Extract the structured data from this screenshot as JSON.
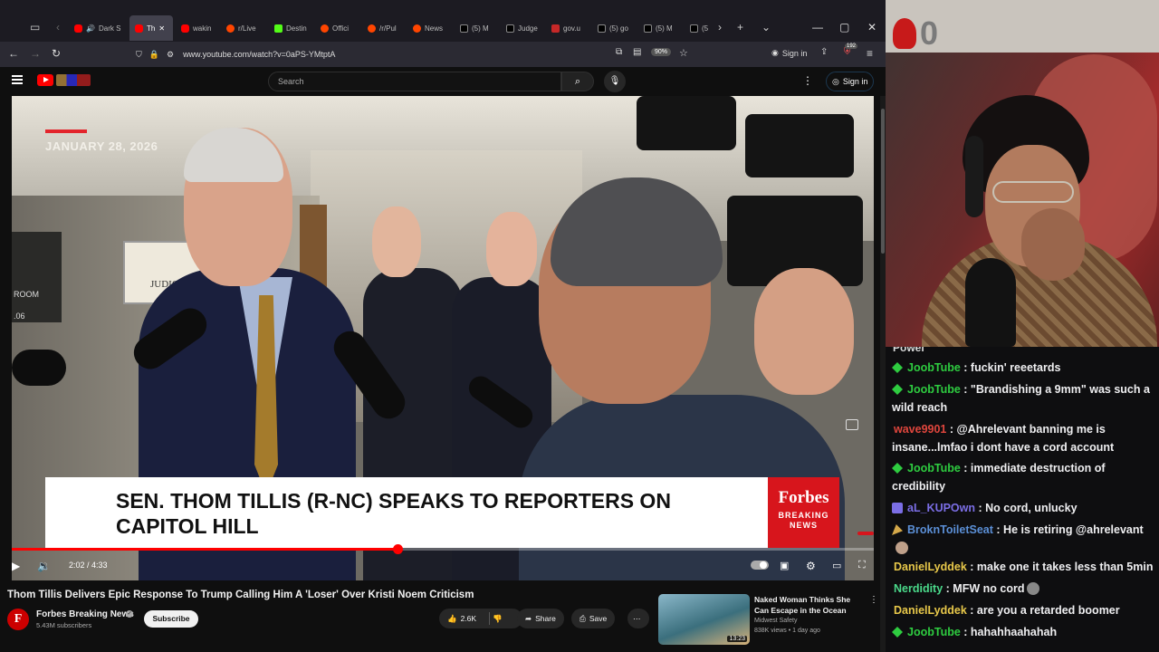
{
  "browser": {
    "tabs": [
      {
        "label": "",
        "icon": "tabs-icon"
      },
      {
        "label": "Dark S",
        "icon": "youtube-favicon"
      },
      {
        "label": "Th",
        "icon": "youtube-favicon",
        "active": true
      },
      {
        "label": "wakin",
        "icon": "youtube-favicon"
      },
      {
        "label": "r/Live",
        "icon": "reddit-favicon"
      },
      {
        "label": "Destin",
        "icon": "kick-favicon"
      },
      {
        "label": "Offici",
        "icon": "reddit-favicon"
      },
      {
        "label": "/r/Pul",
        "icon": "reddit-favicon"
      },
      {
        "label": "News",
        "icon": "reddit-favicon"
      },
      {
        "label": "(5) M",
        "icon": "x-favicon"
      },
      {
        "label": "Judge",
        "icon": "site-favicon"
      },
      {
        "label": "gov.u",
        "icon": "gov-favicon"
      },
      {
        "label": "(5) go",
        "icon": "x-favicon"
      },
      {
        "label": "(5) M",
        "icon": "x-favicon"
      },
      {
        "label": "(5",
        "icon": "x-favicon"
      }
    ],
    "url": "www.youtube.com/watch?v=0aPS-YMtptA",
    "zoom": "90%",
    "signin_label": "Sign in",
    "extension_badge": "192"
  },
  "youtube": {
    "search_placeholder": "Search",
    "signin_label": "Sign in"
  },
  "video": {
    "date_overlay": "JANUARY 28, 2026",
    "lower_third_title": "SEN. THOM TILLIS (R-NC) SPEAKS TO REPORTERS ON CAPITOL HILL",
    "brand_name": "Forbes",
    "brand_sub_1": "BREAKING",
    "brand_sub_2": "NEWS",
    "background_signs": [
      "JUDIC",
      "ROOM",
      ".06"
    ],
    "time_current": "2:02",
    "time_total": "4:33",
    "time_label": "2:02 / 4:33",
    "progress": 0.447
  },
  "info": {
    "title": "Thom Tillis Delivers Epic Response To Trump Calling Him A 'Loser' Over Kristi Noem Criticism",
    "channel": "Forbes Breaking News",
    "channel_initial": "F",
    "subscribers": "5.43M subscribers",
    "subscribe_label": "Subscribe",
    "likes": "2.6K",
    "share_label": "Share",
    "save_label": "Save"
  },
  "recommendation": {
    "title": "Naked Woman Thinks She Can Escape in the Ocean",
    "channel": "Midwest Safety",
    "meta": "838K views • 1 day ago",
    "duration": "13:23"
  },
  "webcam": {
    "overlay_number": "0"
  },
  "chat": {
    "cut_line": "Powel",
    "messages": [
      {
        "user": "JoobTube",
        "color": "#2ecc40",
        "badge": "gem",
        "text": ": fuckin' reeetards"
      },
      {
        "user": "JoobTube",
        "color": "#2ecc40",
        "badge": "gem",
        "text": ": \"Brandishing a 9mm\" was such a wild reach"
      },
      {
        "user": "wave9901",
        "color": "#e0463d",
        "badge": "",
        "text": ": @Ahrelevant banning me is insane...lmfao i dont have a cord account"
      },
      {
        "user": "JoobTube",
        "color": "#2ecc40",
        "badge": "gem",
        "text": ": immediate destruction of credibility"
      },
      {
        "user": "aL_KUPOwn",
        "color": "#7b6ee5",
        "badge": "sq",
        "text": ": No cord, unlucky"
      },
      {
        "user": "BroknToiletSeat",
        "color": "#5b8fd6",
        "badge": "pick",
        "text": ": He is retiring @ahrelevant"
      },
      {
        "user": "DanielLyddek",
        "color": "#e8c84a",
        "badge": "",
        "text": ": make one it takes less than 5min"
      },
      {
        "user": "Nerdidity",
        "color": "#4ad98a",
        "badge": "",
        "text": ": MFW no cord"
      },
      {
        "user": "DanielLyddek",
        "color": "#e8c84a",
        "badge": "",
        "text": ": are you a retarded boomer"
      },
      {
        "user": "JoobTube",
        "color": "#2ecc40",
        "badge": "gem",
        "text": ": hahahhaahahah"
      }
    ]
  }
}
